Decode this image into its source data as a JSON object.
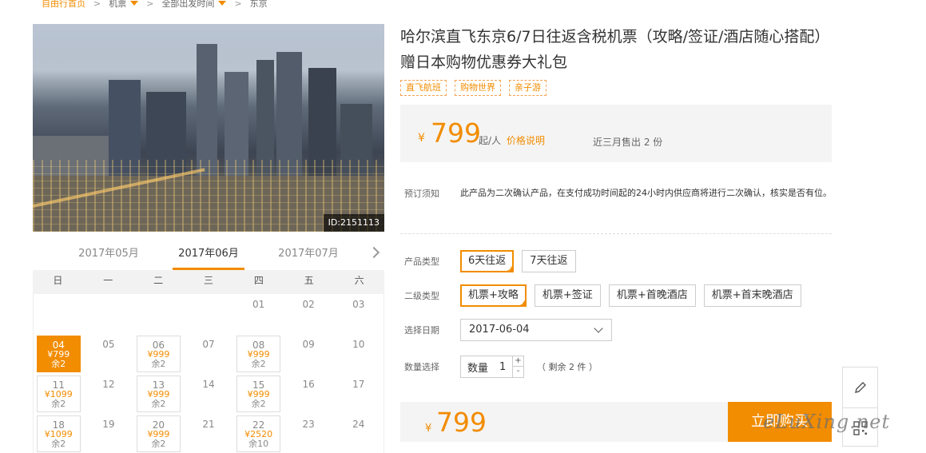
{
  "breadcrumb": [
    {
      "label": "自由行首页",
      "dropdown": false
    },
    {
      "label": "机票",
      "dropdown": true
    },
    {
      "label": "全部出发时间",
      "dropdown": true
    },
    {
      "label": "东京",
      "dropdown": false
    }
  ],
  "hero": {
    "image_id": "ID:2151113"
  },
  "calendar": {
    "months": [
      "2017年05月",
      "2017年06月",
      "2017年07月"
    ],
    "active_month": "2017年06月",
    "weekdays": [
      "日",
      "一",
      "二",
      "三",
      "四",
      "五",
      "六"
    ],
    "rows": [
      [
        {
          "d": ""
        },
        {
          "d": ""
        },
        {
          "d": ""
        },
        {
          "d": ""
        },
        {
          "d": "01"
        },
        {
          "d": "02"
        },
        {
          "d": "03"
        }
      ],
      [
        {
          "d": "04",
          "price": "¥799",
          "remain": "余2",
          "selected": true
        },
        {
          "d": "05"
        },
        {
          "d": "06",
          "price": "¥999",
          "remain": "余2"
        },
        {
          "d": "07"
        },
        {
          "d": "08",
          "price": "¥999",
          "remain": "余2"
        },
        {
          "d": "09"
        },
        {
          "d": "10"
        }
      ],
      [
        {
          "d": "11",
          "price": "¥1099",
          "remain": "余2"
        },
        {
          "d": "12"
        },
        {
          "d": "13",
          "price": "¥999",
          "remain": "余2"
        },
        {
          "d": "14"
        },
        {
          "d": "15",
          "price": "¥999",
          "remain": "余2"
        },
        {
          "d": "16"
        },
        {
          "d": "17"
        }
      ],
      [
        {
          "d": "18",
          "price": "¥1099",
          "remain": "余2"
        },
        {
          "d": "19"
        },
        {
          "d": "20",
          "price": "¥999",
          "remain": "余2"
        },
        {
          "d": "21"
        },
        {
          "d": "22",
          "price": "¥2520",
          "remain": "余10"
        },
        {
          "d": "23"
        },
        {
          "d": "24"
        }
      ]
    ]
  },
  "product": {
    "title": "哈尔滨直飞东京6/7日往返含税机票（攻略/签证/酒店随心搭配）赠日本购物优惠券大礼包",
    "tags": [
      "直飞航班",
      "购物世界",
      "亲子游"
    ],
    "price": {
      "currency": "¥",
      "amount": "799",
      "unit": "起/人",
      "explain": "价格说明",
      "sold": "近三月售出 2 份"
    },
    "notice": {
      "label": "预订须知",
      "text": "此产品为二次确认产品，在支付成功时间起的24小时内供应商将进行二次确认，核实是否有位。"
    },
    "product_type": {
      "label": "产品类型",
      "options": [
        "6天往返",
        "7天往返"
      ],
      "selected": "6天往返"
    },
    "sub_type": {
      "label": "二级类型",
      "options": [
        "机票+攻略",
        "机票+签证",
        "机票+首晚酒店",
        "机票+首末晚酒店"
      ],
      "selected": "机票+攻略"
    },
    "date": {
      "label": "选择日期",
      "value": "2017-06-04"
    },
    "quantity": {
      "label": "数量选择",
      "field_label": "数量",
      "value": "1",
      "plus": "+",
      "minus": "-",
      "remain": "（ 剩余 2 件 ）"
    }
  },
  "buy": {
    "currency": "¥",
    "amount": "799",
    "button": "立即购买"
  },
  "watermark": "eLuXing.net",
  "colors": {
    "accent": "#f28c00",
    "panel": "#f4f4f4"
  },
  "icons": {
    "edit": "pencil-icon",
    "qr": "qr-code-icon"
  }
}
